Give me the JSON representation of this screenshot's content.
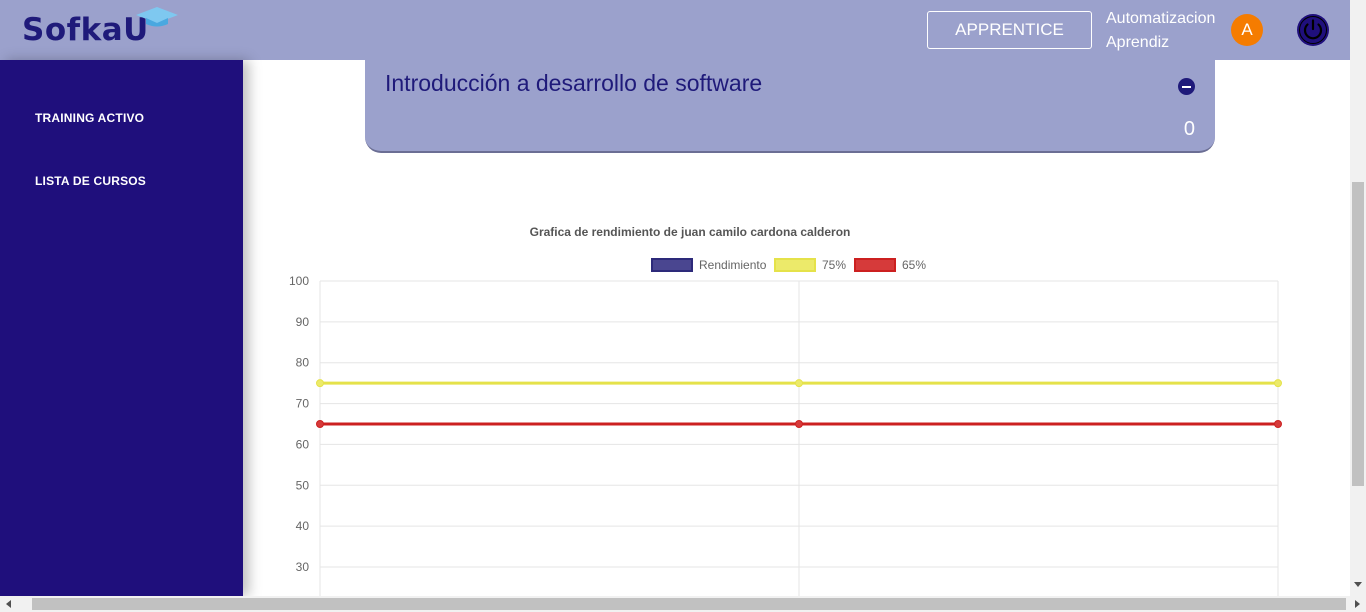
{
  "header": {
    "logo_text": "Sofka",
    "logo_u": "U",
    "role_button": "APPRENTICE",
    "user_line1": "Automatizacion",
    "user_line2": "Aprendiz",
    "avatar_initial": "A",
    "power_icon": "power-icon",
    "colors": {
      "bar": "#9ba1cc",
      "brand": "#1f1a7a",
      "avatar": "#f57c00"
    }
  },
  "sidebar": {
    "items": [
      {
        "label": "TRAINING ACTIVO"
      },
      {
        "label": "LISTA DE CURSOS"
      }
    ],
    "color": "#1f0f7c"
  },
  "course": {
    "title": "Introducción a desarrollo de software",
    "count": "0",
    "collapse_icon": "minus-circle-icon"
  },
  "chart_data": {
    "type": "line",
    "title": "Grafica de rendimiento de juan camilo cardona calderon",
    "x": [
      0,
      1,
      2
    ],
    "ylim": [
      30,
      100
    ],
    "yticks": [
      30,
      40,
      50,
      60,
      70,
      80,
      90,
      100
    ],
    "grid": true,
    "legend_position": "top",
    "series": [
      {
        "name": "Rendimiento",
        "values": [],
        "color": "#2d2a7a",
        "fill": "#4a4690"
      },
      {
        "name": "75%",
        "values": [
          75,
          75,
          75
        ],
        "color": "#e5e24a",
        "fill": "#ecea6a"
      },
      {
        "name": "65%",
        "values": [
          65,
          65,
          65
        ],
        "color": "#cc2020",
        "fill": "#d63a3a"
      }
    ]
  }
}
